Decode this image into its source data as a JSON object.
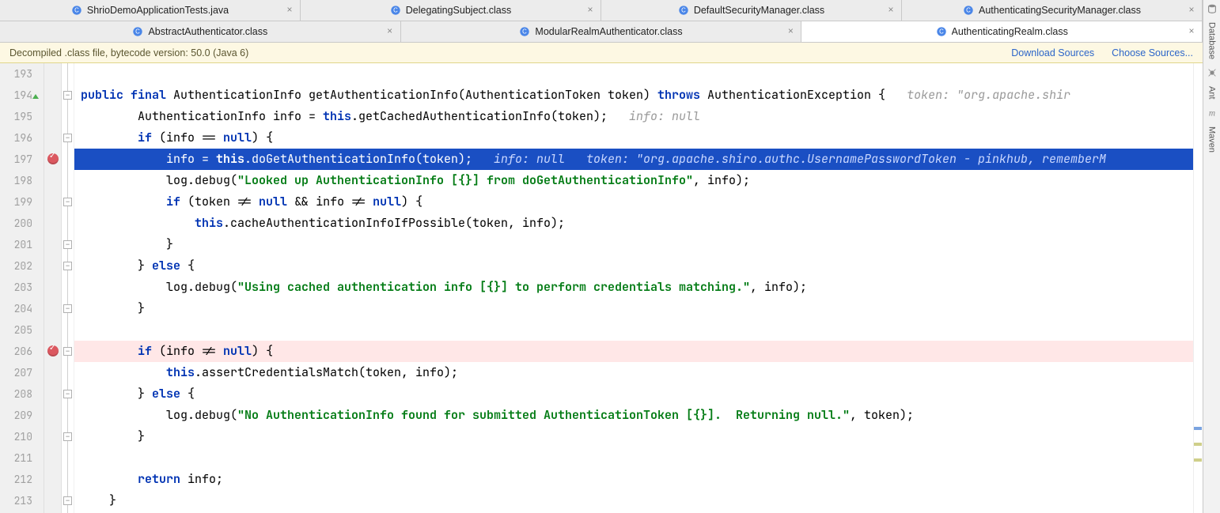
{
  "tabs_row1": [
    {
      "label": "ShrioDemoApplicationTests.java",
      "icon": "class",
      "active": false
    },
    {
      "label": "DelegatingSubject.class",
      "icon": "class",
      "active": false
    },
    {
      "label": "DefaultSecurityManager.class",
      "icon": "class",
      "active": false
    },
    {
      "label": "AuthenticatingSecurityManager.class",
      "icon": "class",
      "active": false
    }
  ],
  "tabs_row2": [
    {
      "label": "AbstractAuthenticator.class",
      "icon": "class",
      "active": false
    },
    {
      "label": "ModularRealmAuthenticator.class",
      "icon": "class",
      "active": false
    },
    {
      "label": "AuthenticatingRealm.class",
      "icon": "class",
      "active": true
    }
  ],
  "notice": {
    "text": "Decompiled .class file, bytecode version: 50.0 (Java 6)",
    "link1": "Download Sources",
    "link2": "Choose Sources..."
  },
  "right_tools": [
    {
      "name": "database",
      "label": "Database"
    },
    {
      "name": "ant",
      "label": "Ant"
    },
    {
      "name": "maven",
      "label": "Maven"
    }
  ],
  "line_start": 193,
  "line_end": 213,
  "exec_line": 197,
  "breakpoints": [
    197,
    206
  ],
  "code": {
    "l194_sig_pre": "    public final ",
    "l194_ret": "AuthenticationInfo getAuthenticationInfo(AuthenticationToken token) ",
    "l194_throws": "throws",
    "l194_after": " AuthenticationException {",
    "l194_hint": "   token: \"org.apache.shir",
    "l195": "        AuthenticationInfo info = ",
    "l195_this": "this",
    "l195_call": ".getCachedAuthenticationInfo(token);",
    "l195_hint": "   info: null",
    "l196_pre": "        ",
    "l196_if": "if",
    "l196_mid": " (info == ",
    "l196_null": "null",
    "l196_end": ") {",
    "l197_pre": "            info = ",
    "l197_this": "this",
    "l197_call": ".doGetAuthenticationInfo(token);",
    "l197_hint": "   info: null   token: \"org.apache.shiro.authc.UsernamePasswordToken - pinkhub, rememberM",
    "l198_pre": "            log.debug(",
    "l198_str": "\"Looked up AuthenticationInfo [{}] from doGetAuthenticationInfo\"",
    "l198_end": ", info);",
    "l199_pre": "            ",
    "l199_if": "if",
    "l199_mid": " (token != ",
    "l199_null1": "null",
    "l199_mid2": " && info != ",
    "l199_null2": "null",
    "l199_end": ") {",
    "l200_pre": "                ",
    "l200_this": "this",
    "l200_call": ".cacheAuthenticationInfoIfPossible(token, info);",
    "l201": "            }",
    "l202_pre": "        } ",
    "l202_else": "else",
    "l202_end": " {",
    "l203_pre": "            log.debug(",
    "l203_str": "\"Using cached authentication info [{}] to perform credentials matching.\"",
    "l203_end": ", info);",
    "l204": "        }",
    "l205": "",
    "l206_pre": "        ",
    "l206_if": "if",
    "l206_mid": " (info != ",
    "l206_null": "null",
    "l206_end": ") {",
    "l207_pre": "            ",
    "l207_this": "this",
    "l207_call": ".assertCredentialsMatch(token, info);",
    "l208_pre": "        } ",
    "l208_else": "else",
    "l208_end": " {",
    "l209_pre": "            log.debug(",
    "l209_str": "\"No AuthenticationInfo found for submitted AuthenticationToken [{}].  Returning null.\"",
    "l209_end": ", token);",
    "l210": "        }",
    "l211": "",
    "l212_pre": "        ",
    "l212_ret": "return",
    "l212_end": " info;",
    "l213": "    }"
  }
}
